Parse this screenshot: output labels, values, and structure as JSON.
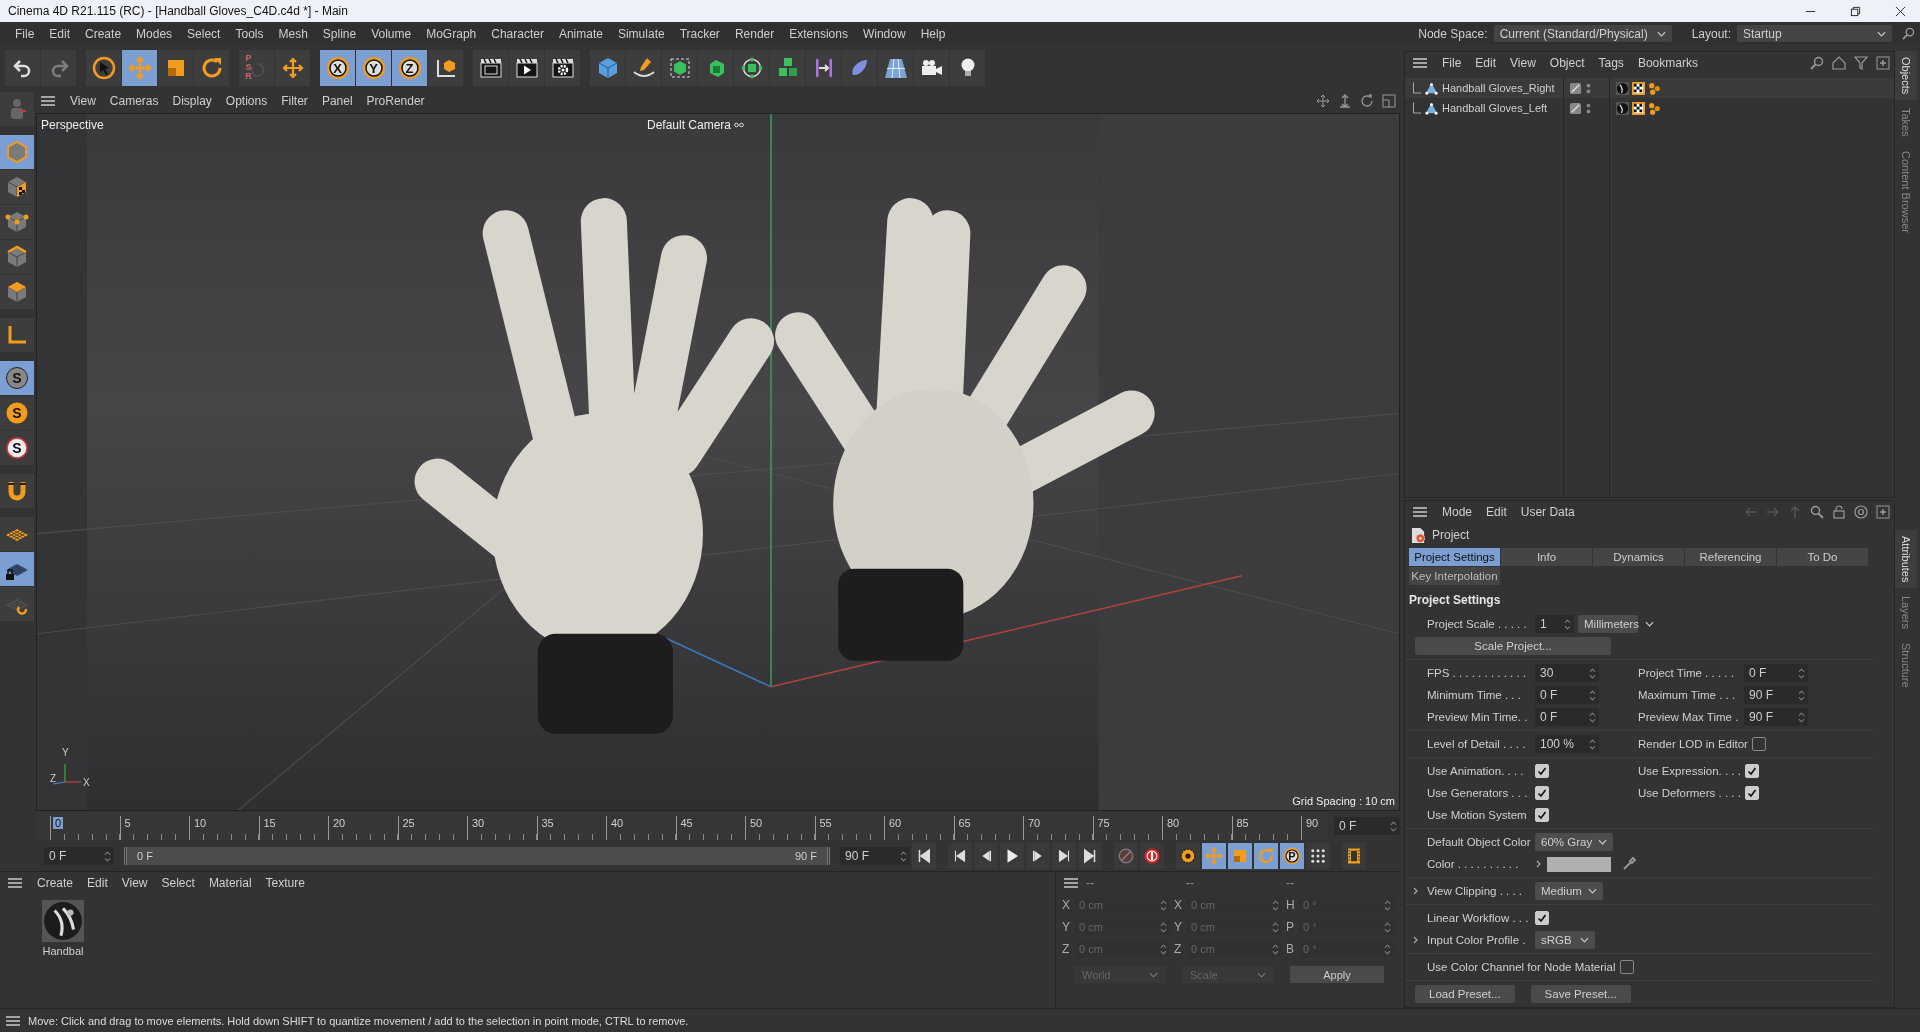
{
  "window": {
    "title": "Cinema 4D R21.115 (RC) - [Handball Gloves_C4D.c4d *] - Main"
  },
  "menu": [
    "File",
    "Edit",
    "Create",
    "Modes",
    "Select",
    "Tools",
    "Mesh",
    "Spline",
    "Volume",
    "MoGraph",
    "Character",
    "Animate",
    "Simulate",
    "Tracker",
    "Render",
    "Extensions",
    "Window",
    "Help"
  ],
  "node_space": {
    "label": "Node Space:",
    "value": "Current (Standard/Physical)"
  },
  "layout": {
    "label": "Layout:",
    "value": "Startup"
  },
  "toolbar": [
    {
      "selected": false,
      "disabled": false
    },
    {
      "selected": false,
      "disabled": true
    },
    {
      "selected": false,
      "disabled": false
    },
    {
      "selected": true,
      "disabled": false
    },
    {
      "selected": false,
      "disabled": false
    },
    {
      "selected": false,
      "disabled": false
    },
    {
      "selected": false,
      "disabled": true,
      "label": "PSR"
    },
    {
      "selected": false,
      "disabled": false
    },
    {
      "selected": true,
      "disabled": false,
      "label": "X"
    },
    {
      "selected": true,
      "disabled": false,
      "label": "Y"
    },
    {
      "selected": true,
      "disabled": false,
      "label": "Z"
    },
    {
      "selected": false,
      "disabled": false
    },
    {
      "selected": false,
      "disabled": false
    },
    {
      "selected": false,
      "disabled": false
    },
    {
      "selected": false,
      "disabled": false
    },
    {
      "selected": false,
      "disabled": false
    },
    {
      "selected": false,
      "disabled": false
    },
    {
      "selected": false,
      "disabled": false
    },
    {
      "selected": false,
      "disabled": false
    },
    {
      "selected": false,
      "disabled": false
    },
    {
      "selected": false,
      "disabled": false
    },
    {
      "selected": false,
      "disabled": false
    },
    {
      "selected": false,
      "disabled": false
    },
    {
      "selected": false,
      "disabled": false
    },
    {
      "selected": false,
      "disabled": false
    },
    {
      "selected": false,
      "disabled": false
    }
  ],
  "tool_strip": [
    {
      "selected": false
    },
    {
      "selected": true
    },
    {
      "selected": false
    },
    {
      "selected": false
    },
    {
      "selected": false
    },
    {
      "selected": false
    },
    {
      "selected": false
    },
    {
      "selected": true,
      "label": "S"
    },
    {
      "selected": false,
      "label": "S"
    },
    {
      "selected": false,
      "label": "S"
    },
    {
      "selected": false
    },
    {
      "selected": false
    },
    {
      "selected": true
    },
    {
      "selected": false
    }
  ],
  "viewport": {
    "menu": [
      "View",
      "Cameras",
      "Display",
      "Options",
      "Filter",
      "Panel",
      "ProRender"
    ],
    "view_name": "Perspective",
    "camera": "Default Camera",
    "grid_spacing": "Grid Spacing : 10 cm",
    "axes": [
      "Y",
      "Z",
      "X"
    ]
  },
  "timeline": {
    "ticks": [
      {
        "label": "0",
        "selected": true
      },
      {
        "label": "5",
        "selected": false
      },
      {
        "label": "10",
        "selected": false
      },
      {
        "label": "15",
        "selected": false
      },
      {
        "label": "20",
        "selected": false
      },
      {
        "label": "25",
        "selected": false
      },
      {
        "label": "30",
        "selected": false
      },
      {
        "label": "35",
        "selected": false
      },
      {
        "label": "40",
        "selected": false
      },
      {
        "label": "45",
        "selected": false
      },
      {
        "label": "50",
        "selected": false
      },
      {
        "label": "55",
        "selected": false
      },
      {
        "label": "60",
        "selected": false
      },
      {
        "label": "65",
        "selected": false
      },
      {
        "label": "70",
        "selected": false
      },
      {
        "label": "75",
        "selected": false
      },
      {
        "label": "80",
        "selected": false
      },
      {
        "label": "85",
        "selected": false
      },
      {
        "label": "90",
        "selected": false
      }
    ],
    "current_field": "0 F",
    "start_field": "0 F",
    "range": {
      "start": "0 F",
      "end": "90 F",
      "level": 1
    },
    "end_field": "90 F"
  },
  "transport": [
    {
      "selected": false
    },
    {
      "selected": false
    },
    {
      "selected": false
    },
    {
      "selected": false
    },
    {
      "selected": false
    },
    {
      "selected": false
    },
    {
      "selected": false
    },
    {
      "selected": false
    },
    {
      "selected": false
    },
    {
      "selected": false
    },
    {
      "selected": true
    },
    {
      "selected": true
    },
    {
      "selected": true
    },
    {
      "selected": true,
      "label": "P"
    },
    {
      "selected": false
    },
    {
      "selected": false
    }
  ],
  "materials": {
    "menu": [
      "Create",
      "Edit",
      "View",
      "Select",
      "Material",
      "Texture"
    ],
    "items": [
      {
        "name": "Handbal"
      }
    ]
  },
  "coordinates": {
    "disabled": true,
    "headers": [
      "--",
      "--",
      "--"
    ],
    "rows": [
      [
        {
          "axis": "X",
          "value": "0 cm"
        },
        {
          "axis": "X",
          "value": "0 cm"
        },
        {
          "axis": "H",
          "value": "0 °"
        }
      ],
      [
        {
          "axis": "Y",
          "value": "0 cm"
        },
        {
          "axis": "Y",
          "value": "0 cm"
        },
        {
          "axis": "P",
          "value": "0 °"
        }
      ],
      [
        {
          "axis": "Z",
          "value": "0 cm"
        },
        {
          "axis": "Z",
          "value": "0 cm"
        },
        {
          "axis": "B",
          "value": "0 °"
        }
      ]
    ],
    "dropdowns": [
      "World",
      "Scale"
    ],
    "apply": "Apply"
  },
  "objects": {
    "menu": [
      "File",
      "Edit",
      "View",
      "Object",
      "Tags",
      "Bookmarks"
    ],
    "rows": [
      {
        "name": "Handball Gloves_Right"
      },
      {
        "name": "Handball Gloves_Left"
      }
    ]
  },
  "attributes": {
    "menu": [
      "Mode",
      "Edit",
      "User Data"
    ],
    "object": "Project",
    "tabs": [
      [
        {
          "label": "Project Settings",
          "selected": true
        },
        {
          "label": "Info",
          "selected": false
        },
        {
          "label": "Dynamics",
          "selected": false
        },
        {
          "label": "Referencing",
          "selected": false
        },
        {
          "label": "To Do",
          "selected": false
        }
      ],
      [
        {
          "label": "Key Interpolation",
          "selected": false
        }
      ]
    ],
    "section": "Project Settings",
    "groups": [
      {
        "rows": [
          {
            "cols": [
              [
                {
                  "kind": "label",
                  "text": "Project Scale . . . . ."
                },
                {
                  "kind": "number",
                  "value": "1"
                },
                {
                  "kind": "dropdown",
                  "value": "Millimeters"
                }
              ]
            ]
          },
          {
            "cols": [
              [
                {
                  "kind": "button",
                  "label": "Scale Project..."
                }
              ]
            ]
          }
        ]
      },
      {
        "rows": [
          {
            "cols": [
              [
                {
                  "kind": "label",
                  "text": "FPS . . . . . . . . . . . ."
                },
                {
                  "kind": "number",
                  "value": "30"
                }
              ],
              [
                {
                  "kind": "label",
                  "text": "Project Time . . . . ."
                },
                {
                  "kind": "number",
                  "value": "0 F"
                }
              ]
            ]
          },
          {
            "cols": [
              [
                {
                  "kind": "label",
                  "text": "Minimum Time . . ."
                },
                {
                  "kind": "number",
                  "value": "0 F"
                }
              ],
              [
                {
                  "kind": "label",
                  "text": "Maximum Time . . ."
                },
                {
                  "kind": "number",
                  "value": "90 F"
                }
              ]
            ]
          },
          {
            "cols": [
              [
                {
                  "kind": "label",
                  "text": "Preview Min Time. ."
                },
                {
                  "kind": "number",
                  "value": "0 F"
                }
              ],
              [
                {
                  "kind": "label",
                  "text": "Preview Max Time ."
                },
                {
                  "kind": "number",
                  "value": "90 F"
                }
              ]
            ]
          }
        ]
      },
      {
        "rows": [
          {
            "cols": [
              [
                {
                  "kind": "label",
                  "text": "Level of Detail . . . ."
                },
                {
                  "kind": "number",
                  "value": "100 %"
                }
              ],
              [
                {
                  "kind": "label",
                  "text": "Render LOD in Editor"
                },
                {
                  "kind": "checkbox",
                  "checked": false
                }
              ]
            ]
          }
        ]
      },
      {
        "rows": [
          {
            "cols": [
              [
                {
                  "kind": "label",
                  "text": "Use Animation. . . ."
                },
                {
                  "kind": "checkbox",
                  "checked": true
                }
              ],
              [
                {
                  "kind": "label",
                  "text": "Use Expression. . . ."
                },
                {
                  "kind": "checkbox",
                  "checked": true
                }
              ]
            ]
          },
          {
            "cols": [
              [
                {
                  "kind": "label",
                  "text": "Use Generators . . ."
                },
                {
                  "kind": "checkbox",
                  "checked": true
                }
              ],
              [
                {
                  "kind": "label",
                  "text": "Use Deformers . . . ."
                },
                {
                  "kind": "checkbox",
                  "checked": true
                }
              ]
            ]
          },
          {
            "cols": [
              [
                {
                  "kind": "label",
                  "text": "Use Motion System"
                },
                {
                  "kind": "checkbox",
                  "checked": true
                }
              ]
            ]
          }
        ]
      },
      {
        "rows": [
          {
            "cols": [
              [
                {
                  "kind": "label",
                  "text": "Default Object Color"
                },
                {
                  "kind": "dropdown",
                  "value": "60% Gray"
                }
              ]
            ]
          },
          {
            "cols": [
              [
                {
                  "kind": "label",
                  "text": "Color . . . . . . . . . ."
                },
                {
                  "kind": "swatch",
                  "color": "#b0b0b0"
                }
              ]
            ]
          }
        ]
      },
      {
        "rows": [
          {
            "expanded": false,
            "cols": [
              [
                {
                  "kind": "label",
                  "text": "View Clipping . . . ."
                },
                {
                  "kind": "dropdown",
                  "value": "Medium"
                }
              ]
            ]
          }
        ]
      },
      {
        "rows": [
          {
            "cols": [
              [
                {
                  "kind": "label",
                  "text": "Linear Workflow . . ."
                },
                {
                  "kind": "checkbox",
                  "checked": true
                }
              ]
            ]
          },
          {
            "expanded": false,
            "cols": [
              [
                {
                  "kind": "label",
                  "text": "Input Color Profile ."
                },
                {
                  "kind": "dropdown",
                  "value": "sRGB"
                }
              ]
            ]
          }
        ]
      },
      {
        "rows": [
          {
            "cols": [
              [
                {
                  "kind": "label",
                  "text": "Use Color Channel for Node Material"
                },
                {
                  "kind": "checkbox",
                  "checked": false
                }
              ]
            ]
          }
        ]
      },
      {
        "rows": [
          {
            "cols": [
              [
                {
                  "kind": "button",
                  "label": "Load Preset..."
                },
                {
                  "kind": "button",
                  "label": "Save Preset..."
                }
              ]
            ]
          }
        ]
      }
    ]
  },
  "side_tabs": {
    "top": [
      {
        "label": "Objects",
        "selected": true
      },
      {
        "label": "Takes",
        "selected": false
      },
      {
        "label": "Content Browser",
        "selected": false
      }
    ],
    "bottom": [
      {
        "label": "Attributes",
        "selected": true
      },
      {
        "label": "Layers",
        "selected": false
      },
      {
        "label": "Structure",
        "selected": false
      }
    ]
  },
  "status_bar": "Move: Click and drag to move elements. Hold down SHIFT to quantize movement / add to the selection in point mode, CTRL to remove."
}
